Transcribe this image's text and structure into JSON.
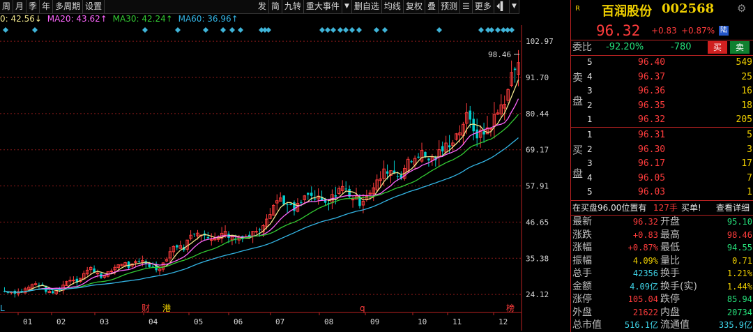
{
  "toolbar": {
    "left": [
      "周",
      "月",
      "季",
      "年",
      "多周期",
      "设置"
    ],
    "right": [
      "发",
      "简",
      "九转",
      "重大事件",
      "▼",
      "删自选",
      "均线",
      "复权",
      "叠",
      "预测",
      "☰",
      "更多",
      "⏴▍",
      "▼"
    ]
  },
  "ma_legend": {
    "ma10": "0: 42.56↓",
    "ma20": "MA20: 43.62↑",
    "ma30": "MA30: 42.24↑",
    "ma60": "MA60: 36.96↑"
  },
  "colors": {
    "ma10": "#f0e68c",
    "ma20": "#ff66ff",
    "ma30": "#33cc33",
    "ma60": "#33b5e5",
    "up": "#ff3c3c",
    "down": "#00d0d0",
    "grid": "#8b1a1a"
  },
  "chart": {
    "y_labels": [
      "102.97",
      "91.70",
      "80.44",
      "69.17",
      "57.91",
      "46.65",
      "35.38",
      "24.12"
    ],
    "max_label": "98.46",
    "months": [
      "01",
      "02",
      "03",
      "04",
      "05",
      "06",
      "07",
      "08",
      "09",
      "10",
      "11",
      "12"
    ],
    "event_marks": [
      {
        "label": "L",
        "color": "#33b5e5"
      },
      {
        "label": "财",
        "color": "#ff3c3c"
      },
      {
        "label": "港",
        "color": "#f0d000"
      },
      {
        "label": "q",
        "color": "#ff3c3c"
      },
      {
        "label": "榜",
        "color": "#ff3c3c"
      }
    ]
  },
  "chart_data": {
    "type": "candlestick",
    "ylim": [
      18.5,
      108
    ],
    "months": [
      "01",
      "02",
      "03",
      "04",
      "05",
      "06",
      "07",
      "08",
      "09",
      "10",
      "11",
      "12"
    ],
    "close_series": [
      25.2,
      25.0,
      24.8,
      25.5,
      26.8,
      27.6,
      25.9,
      24.2,
      25.4,
      27.3,
      29.1,
      28.4,
      30.6,
      32.2,
      31.1,
      29.4,
      31.0,
      33.2,
      34.1,
      32.6,
      33.8,
      34.6,
      33.1,
      32.0,
      33.5,
      37.2,
      39.8,
      38.1,
      41.5,
      44.2,
      43.4,
      40.6,
      42.0,
      43.8,
      42.5,
      41.3,
      42.4,
      42.0,
      43.9,
      45.6,
      49.1,
      52.6,
      54.3,
      51.5,
      50.2,
      52.8,
      55.1,
      54.0,
      53.2,
      51.5,
      55.2,
      57.8,
      56.1,
      54.0,
      52.8,
      55.5,
      57.0,
      60.4,
      63.1,
      62.5,
      60.8,
      64.5,
      66.2,
      68.4,
      66.7,
      65.9,
      68.0,
      70.2,
      72.5,
      74.8,
      79.6,
      76.4,
      73.2,
      75.0,
      77.8,
      81.0,
      85.5,
      92.4,
      96.32
    ],
    "ma_values": {
      "MA10": 42.56,
      "MA20": 43.62,
      "MA30": 42.24,
      "MA60": 36.96
    }
  },
  "panel": {
    "name": "百润股份",
    "code": "002568",
    "badge": "R",
    "price": "96.32",
    "change": "+0.83",
    "change_pct": "+0.87%",
    "tag": "陆",
    "weibi_label": "委比",
    "weibi_pct": "-92.20%",
    "weibi_val": "-780",
    "buy_btn": "买",
    "sell_btn": "卖",
    "sell_side_label": [
      "卖",
      "盘"
    ],
    "buy_side_label": [
      "买",
      "盘"
    ],
    "sells": [
      {
        "lvl": "5",
        "price": "96.40",
        "vol": "549"
      },
      {
        "lvl": "4",
        "price": "96.37",
        "vol": "25"
      },
      {
        "lvl": "3",
        "price": "96.36",
        "vol": "16"
      },
      {
        "lvl": "2",
        "price": "96.35",
        "vol": "18"
      },
      {
        "lvl": "1",
        "price": "96.32",
        "vol": "205"
      }
    ],
    "buys": [
      {
        "lvl": "1",
        "price": "96.31",
        "vol": "5"
      },
      {
        "lvl": "2",
        "price": "96.30",
        "vol": "3"
      },
      {
        "lvl": "3",
        "price": "96.17",
        "vol": "17"
      },
      {
        "lvl": "4",
        "price": "96.05",
        "vol": "7"
      },
      {
        "lvl": "5",
        "price": "96.03",
        "vol": "1"
      }
    ],
    "notice_a": "在买盘96.00位置有",
    "notice_b": "127手",
    "notice_c": "买单!",
    "notice_link": "查看详细",
    "stats": [
      {
        "l1": "最新",
        "v1": "96.32",
        "c1": "red",
        "l2": "开盘",
        "v2": "95.10",
        "c2": "green"
      },
      {
        "l1": "涨跌",
        "v1": "+0.83",
        "c1": "red",
        "l2": "最高",
        "v2": "98.46",
        "c2": "red"
      },
      {
        "l1": "涨幅",
        "v1": "+0.87%",
        "c1": "red",
        "l2": "最低",
        "v2": "94.55",
        "c2": "green"
      },
      {
        "l1": "振幅",
        "v1": "4.09%",
        "c1": "yellow",
        "l2": "量比",
        "v2": "0.71",
        "c2": "yellow"
      },
      {
        "l1": "总手",
        "v1": "42356",
        "c1": "cyan",
        "l2": "换手",
        "v2": "1.21%",
        "c2": "yellow"
      },
      {
        "l1": "金额",
        "v1": "4.09亿",
        "c1": "cyan",
        "l2": "换手(实)",
        "v2": "1.44%",
        "c2": "yellow"
      },
      {
        "l1": "涨停",
        "v1": "105.04",
        "c1": "red",
        "l2": "跌停",
        "v2": "85.94",
        "c2": "green"
      },
      {
        "l1": "外盘",
        "v1": "21622",
        "c1": "red",
        "l2": "内盘",
        "v2": "20734",
        "c2": "green"
      },
      {
        "l1": "总市值",
        "v1": "516.1亿",
        "c1": "cyan",
        "l2": "流通值",
        "v2": "335.9亿",
        "c2": "cyan"
      }
    ]
  }
}
